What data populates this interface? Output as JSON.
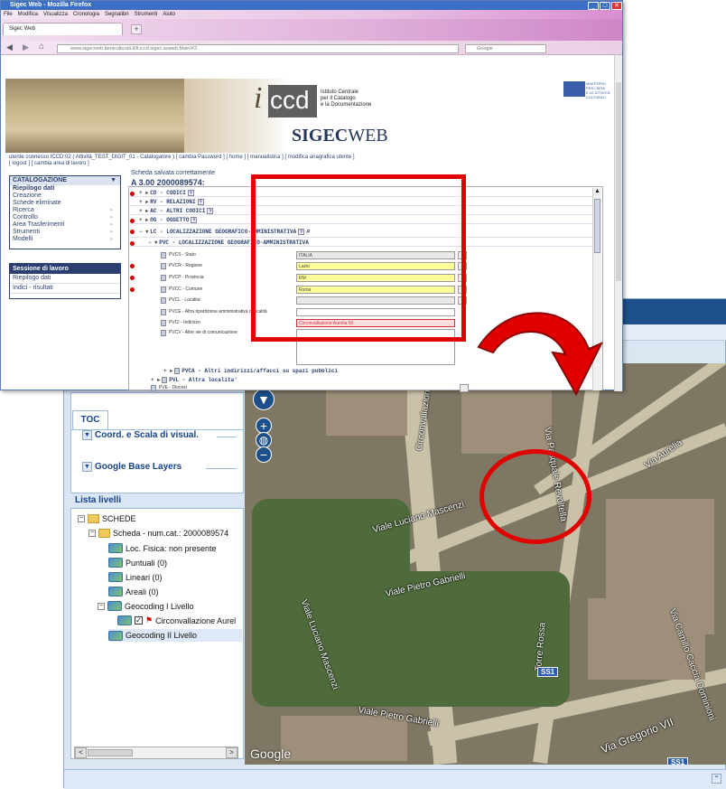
{
  "gis": {
    "toc_tab": "TOC",
    "section_coord": "Coord. e Scala di visual.",
    "section_google": "Google Base Layers",
    "list_header": "Lista livelli",
    "tree": [
      {
        "label": "SCHEDE"
      },
      {
        "label": "Scheda - num.cat.: 2000089574"
      },
      {
        "label": "Loc. Fisica: non presente"
      },
      {
        "label": "Puntuali (0)"
      },
      {
        "label": "Lineari (0)"
      },
      {
        "label": "Areali (0)"
      },
      {
        "label": "Geocoding I Livello"
      },
      {
        "label": "Circonvallazione Aurel"
      },
      {
        "label": "Geocoding II Livello"
      }
    ],
    "map_labels": {
      "aurelia": "Circonvallazione Aurelia",
      "via_aurelia": "Via Aurelia",
      "mascenzi": "Viale Luciano Mascenzi",
      "pietro": "Viale Pietro Gabrielli",
      "gabrielli": "Viale Pietro Gabrielli",
      "luciano": "Viale Luciano Mascenzi",
      "torre_rossa": "Torre Rossa",
      "gregorio": "Via Gregorio VII",
      "pasquale": "Via Pasquale Revoltella",
      "camillo": "Via Camillo Caccia Dominioni",
      "ss1": "SS1",
      "google": "Google"
    }
  },
  "browser": {
    "title": "Sigec Web - Mozilla Firefox",
    "menu": [
      "File",
      "Modifica",
      "Visualizza",
      "Cronologia",
      "Segnalibri",
      "Strumenti",
      "Aiuto"
    ],
    "tab_label": "Sigec Web",
    "url": "www.sigecweb.beniculturali.it/it.iccd.sigec.auweb.Main/#3",
    "search": "Google",
    "iccd": "ccd",
    "institute": [
      "Istituto Centrale",
      "per il Catalogo",
      "e la Documentazione"
    ],
    "sigec": "SIGEC",
    "sigec_web": "WEB",
    "ministry": [
      "MINISTERO",
      "PER I BENI",
      "E LE ATTIVITÀ",
      "CULTURALI"
    ],
    "user_line": "utente connesso ICCD 02 ( Attività_TEST_DIGIT_01 - Catalogatore ) [ cambia Password ] [ home ] [ manualistica ] [ modifica anagrafica utente ]",
    "user_line2": "[ logout ] [ cambia area di lavoro ]"
  },
  "left_menu": {
    "header": "CATALOGAZIONE",
    "items": [
      "Riepilogo dati",
      "Creazione",
      "Schede eliminate",
      "Ricerca",
      "Controllo",
      "Area Trasferimenti",
      "Strumenti",
      "Modelli"
    ],
    "session_header": "Sessione di lavoro",
    "session_items": [
      "Riepilogo dati",
      "Indici - risultati"
    ]
  },
  "form": {
    "saved": "Scheda salvata correttamente",
    "code": "A 3.00 2000089574:",
    "sections": [
      "CD - CODICI",
      "RV - RELAZIONI",
      "AC - ALTRI CODICI",
      "OG - OGGETTO",
      "LC - LOCALIZZAZIONE GEOGRAFICO-AMMINISTRATIVA",
      "PVC - LOCALIZZAZIONE GEOGRAFICO-AMMINISTRATIVA"
    ],
    "fields": [
      {
        "label": "PVCS - Stato",
        "value": "ITALIA"
      },
      {
        "label": "PVCR - Regione",
        "value": "Lazio"
      },
      {
        "label": "PVCP - Provincia",
        "value": "RM"
      },
      {
        "label": "PVCC - Comune",
        "value": "Roma"
      },
      {
        "label": "PVCL - Localita'",
        "value": ""
      },
      {
        "label": "PVCE - Altra ripartizione amministrativa o località",
        "value": ""
      },
      {
        "label": "PVCI - Indirizzo",
        "value": "Circonvallazione Aurelia 50"
      },
      {
        "label": "PVCV - Altre vie di comunicazione",
        "value": ""
      }
    ],
    "pvca": "PVCA - Altri indirizzi/affacci su spazi pubblici",
    "pvl": "PVL - Altra localita'",
    "pve": "PVE - Diocesi"
  },
  "colors": {
    "highlight": "#e00000",
    "required_field": "#ffff99",
    "address_field": "#ffdde0"
  }
}
